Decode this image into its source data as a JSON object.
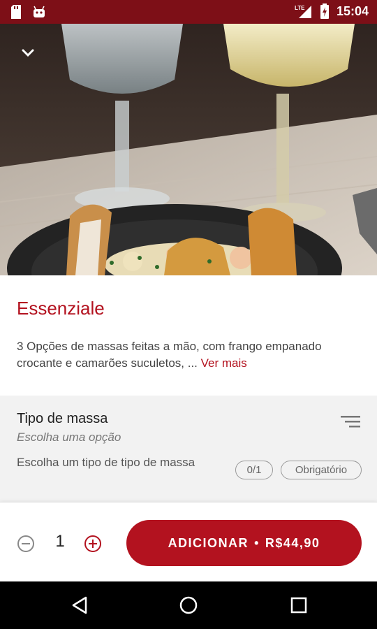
{
  "status_bar": {
    "network": "LTE",
    "time": "15:04"
  },
  "hero": {
    "image_icon": "food-photo",
    "collapse_icon": "chevron-down-icon"
  },
  "product": {
    "title": "Essenziale",
    "description": "3 Opções de massas feitas a mão, com frango empanado crocante e camarões suculetos, ...",
    "more_label": "Ver mais"
  },
  "options": {
    "title": "Tipo de massa",
    "subtitle": "Escolha uma opção",
    "description": "Escolha um tipo de tipo de massa",
    "count_badge": "0/1",
    "required_badge": "Obrigatório",
    "filter_icon": "filter-icon"
  },
  "order": {
    "quantity": "1",
    "add_label": "ADICIONAR",
    "separator": "•",
    "price": "R$44,90"
  },
  "colors": {
    "brand": "#b3121f",
    "status_bar": "#7d0f17"
  }
}
